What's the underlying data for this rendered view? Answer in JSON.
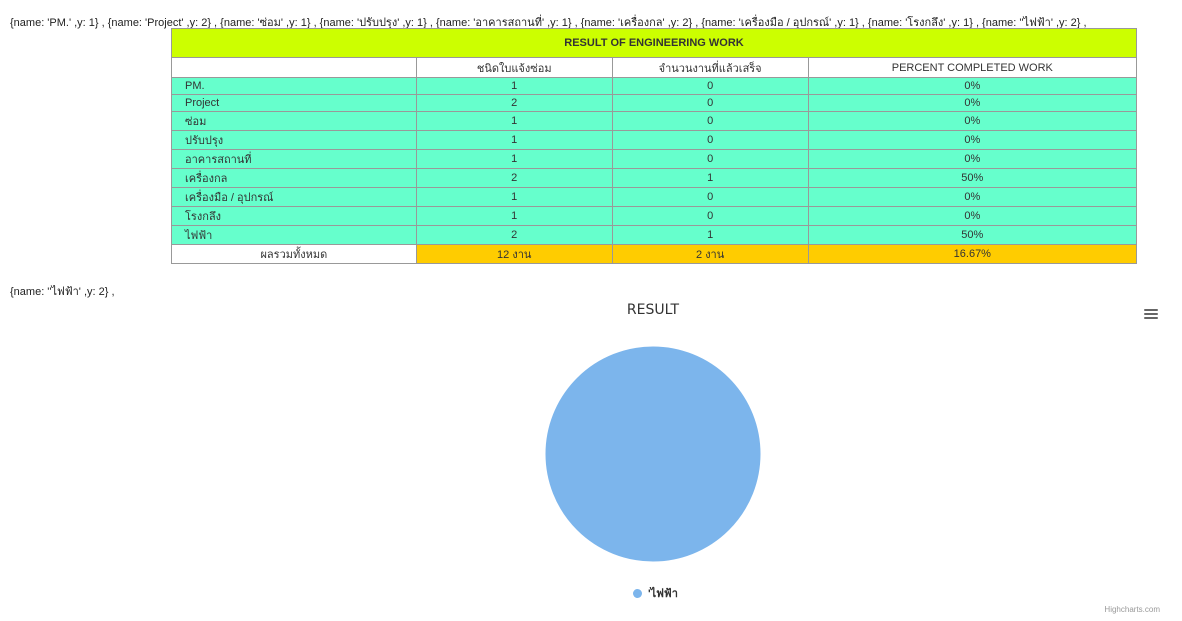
{
  "raw_data_line": "{name: 'PM.' ,y: 1} , {name: 'Project' ,y: 2} , {name: 'ซ่อม' ,y: 1} , {name: 'ปรับปรุง' ,y: 1} , {name: 'อาคารสถานที่' ,y: 1} , {name: 'เครื่องกล' ,y: 2} , {name: 'เครื่องมือ / อุปกรณ์' ,y: 1} , {name: 'โรงกลึง' ,y: 1} , {name: ''ไฟฟ้า' ,y: 2} ,",
  "raw_chart_line": "{name: ''ไฟฟ้า' ,y: 2} ,",
  "table": {
    "title": "RESULT OF ENGINEERING WORK",
    "headers": [
      "",
      "ชนิดใบแจ้งซ่อม",
      "จำนวนงานที่แล้วเสร็จ",
      "PERCENT COMPLETED WORK"
    ],
    "rows": [
      [
        "PM.",
        "1",
        "0",
        "0%"
      ],
      [
        "Project",
        "2",
        "0",
        "0%"
      ],
      [
        "ซ่อม",
        "1",
        "0",
        "0%"
      ],
      [
        "ปรับปรุง",
        "1",
        "0",
        "0%"
      ],
      [
        "อาคารสถานที่",
        "1",
        "0",
        "0%"
      ],
      [
        "เครื่องกล",
        "2",
        "1",
        "50%"
      ],
      [
        "เครื่องมือ / อุปกรณ์",
        "1",
        "0",
        "0%"
      ],
      [
        "โรงกลึง",
        "1",
        "0",
        "0%"
      ],
      [
        "ไฟฟ้า",
        "2",
        "1",
        "50%"
      ]
    ],
    "total": [
      "ผลรวมทั้งหมด",
      "12 งาน",
      "2 งาน",
      "16.67%"
    ],
    "colors": {
      "title": "#ccff00",
      "row": "#66ffcc",
      "total": "#ffcc00"
    }
  },
  "chart_data": {
    "type": "pie",
    "title": "RESULT",
    "slices": [
      {
        "name": "'ไฟฟ้า",
        "value": 2,
        "color": "#7cb5ec"
      }
    ],
    "legend": "bottom",
    "menu_icon": "hamburger-menu-icon",
    "credits": "Highcharts.com"
  }
}
